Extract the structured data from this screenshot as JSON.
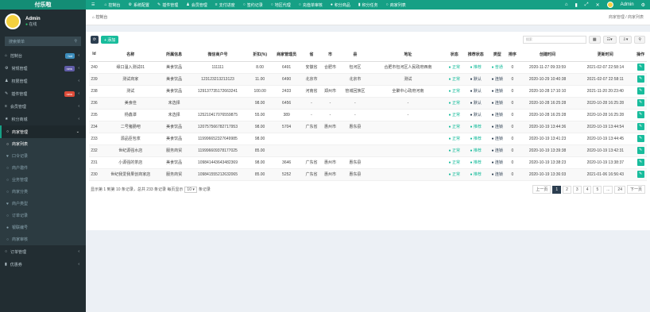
{
  "app": {
    "logo": "付乐啦"
  },
  "topnav": [
    {
      "icon": "☰",
      "label": ""
    },
    {
      "icon": "⌂",
      "label": "控制台"
    },
    {
      "icon": "⚙",
      "label": "系统配置"
    },
    {
      "icon": "✎",
      "label": "插件管理"
    },
    {
      "icon": "♟",
      "label": "会员管理"
    },
    {
      "icon": "≡",
      "label": "支付进度"
    },
    {
      "icon": "○",
      "label": "签约记录"
    },
    {
      "icon": "○",
      "label": "地区代理"
    },
    {
      "icon": "○",
      "label": "充值单审核"
    },
    {
      "icon": "●",
      "label": "积分商品"
    },
    {
      "icon": "▮",
      "label": "积分任务"
    },
    {
      "icon": "○",
      "label": "商家列表"
    }
  ],
  "topright": {
    "user": "Admin",
    "icons": [
      "⌂",
      "▮",
      "⤢",
      "✕"
    ]
  },
  "sidebar": {
    "user": "Admin",
    "status": "在线",
    "search_placeholder": "搜索菜单",
    "items": [
      {
        "icon": "⌂",
        "label": "控制台",
        "badge": "hot",
        "badge_color": "#3c8dbc"
      },
      {
        "icon": "⚙",
        "label": "常规管理",
        "badge": "new",
        "badge_color": "#605ca8"
      },
      {
        "icon": "♟",
        "label": "权限管理",
        "badge": "",
        "badge_color": ""
      },
      {
        "icon": "✎",
        "label": "插件管理",
        "badge": "new",
        "badge_color": "#dd4b39"
      },
      {
        "icon": "≡",
        "label": "会员管理",
        "badge": "",
        "badge_color": ""
      },
      {
        "icon": "★",
        "label": "积分商城",
        "badge": "",
        "badge_color": ""
      },
      {
        "icon": "○",
        "label": "商家管理",
        "badge": "",
        "badge_color": "",
        "active": true
      }
    ],
    "subitems": [
      {
        "icon": "○",
        "label": "商家列表",
        "active": true
      },
      {
        "icon": "♥",
        "label": "口令记录"
      },
      {
        "icon": "○",
        "label": "商户邀件"
      },
      {
        "icon": "○",
        "label": "业务管理"
      },
      {
        "icon": "○",
        "label": "商家分类"
      },
      {
        "icon": "♥",
        "label": "商户类型"
      },
      {
        "icon": "○",
        "label": "订单记录"
      },
      {
        "icon": "●",
        "label": "银联编号"
      },
      {
        "icon": "○",
        "label": "商家审核"
      }
    ],
    "bottom_items": [
      {
        "icon": "○",
        "label": "订单管理"
      },
      {
        "icon": "▮",
        "label": "优惠券"
      }
    ]
  },
  "breadcrumb": {
    "left": "控制台",
    "right": "商家管理 / 商家列表"
  },
  "toolbar": {
    "refresh": "⟳",
    "add": "+ 添加",
    "search_placeholder": "搜索"
  },
  "table": {
    "headers": [
      "Id",
      "名称",
      "所属信息",
      "微信商户号",
      "折扣(%)",
      "商家管理员",
      "省",
      "市",
      "县",
      "地址",
      "状态",
      "推荐状态",
      "类型",
      "排序",
      "创建时间",
      "更新时间",
      "操作"
    ],
    "rows": [
      [
        "240",
        "缘口温入测试01",
        "美食饮品",
        "111111",
        "8.00",
        "6491",
        "安徽省",
        "合肥市",
        "包河区",
        "合肥市包河区人民政府西南",
        "正常",
        "推荐",
        "普通",
        "0",
        "2020-11-27 09:33:59",
        "2021-02-07 22:58:14"
      ],
      [
        "239",
        "测试商家",
        "美食饮品",
        "123123213213123",
        "11.00",
        "6490",
        "北京市",
        "",
        "北京市",
        "测试",
        "正常",
        "默认",
        "连锁",
        "0",
        "2020-10-29 10:40:38",
        "2021-02-07 22:58:11"
      ],
      [
        "238",
        "测试",
        "美食饮品",
        "129137735172663241",
        "100.00",
        "2433",
        "河南省",
        "郑州市",
        "管城回族区",
        "全聚中心政府河南",
        "正常",
        "默认",
        "连锁",
        "0",
        "2020-10-28 17:10:10",
        "2021-11-20 20:23:40"
      ],
      [
        "236",
        "美食佳",
        "未选择",
        "",
        "98.00",
        "6456",
        "-",
        "-",
        "-",
        "-",
        "正常",
        "默认",
        "连锁",
        "0",
        "2020-10-28 16:25:28",
        "2020-10-28 16:25:28"
      ],
      [
        "235",
        "杨鑫潭",
        "未选择",
        "125210417076559875",
        "55.00",
        "389",
        "-",
        "-",
        "-",
        "-",
        "正常",
        "默认",
        "连锁",
        "0",
        "2020-10-28 16:25:28",
        "2020-10-28 16:25:28"
      ],
      [
        "234",
        "二号猪肠吧",
        "美食饮品",
        "120757566782717953",
        "98.00",
        "5704",
        "广东省",
        "惠州市",
        "惠东县",
        "",
        "正常",
        "推荐",
        "连锁",
        "0",
        "2020-10-19 13:44:36",
        "2020-10-19 13:44:54"
      ],
      [
        "233",
        "源品臣包浆",
        "美食饮品",
        "119996652327649985",
        "98.00",
        "",
        "",
        "",
        "",
        "",
        "正常",
        "推荐",
        "连锁",
        "0",
        "2020-10-19 13:41:23",
        "2020-10-19 13:44:45"
      ],
      [
        "232",
        "世纪源强水店",
        "服务商贸",
        "119996609378177025",
        "85.00",
        "",
        "",
        "",
        "",
        "",
        "正常",
        "推荐",
        "连锁",
        "0",
        "2020-10-19 13:39:38",
        "2020-10-19 13:42:31"
      ],
      [
        "231",
        "小源强的茶店",
        "美食饮品",
        "109841443643482369",
        "98.00",
        "3646",
        "广东省",
        "惠州市",
        "惠东县",
        "",
        "正常",
        "推荐",
        "连锁",
        "0",
        "2020-10-19 13:38:23",
        "2020-10-19 13:38:37"
      ],
      [
        "230",
        "世纪我爱我果创商家店",
        "服务商贸",
        "109841555212632065",
        "85.00",
        "5252",
        "广东省",
        "惠州市",
        "惠东县",
        "",
        "正常",
        "推荐",
        "连锁",
        "0",
        "2020-10-19 13:36:03",
        "2021-01-06 16:56:43"
      ]
    ]
  },
  "footer": {
    "summary": "显示第 1 到第 10 条记录，总共 233 条记录 每页显示",
    "per_page": "10 ▾",
    "suffix": "条记录",
    "pages": [
      "上一页",
      "1",
      "2",
      "3",
      "4",
      "5",
      "...",
      "24",
      "下一页"
    ]
  }
}
